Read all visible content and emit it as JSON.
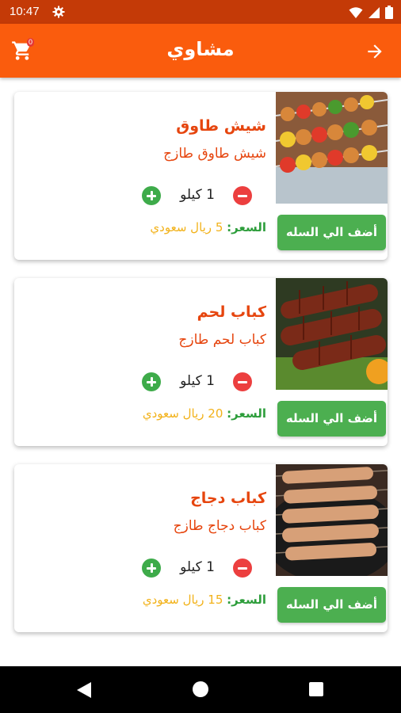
{
  "status_bar": {
    "time": "10:47",
    "icons": [
      "gear-icon",
      "wifi-icon",
      "signal-icon",
      "battery-icon"
    ]
  },
  "app_bar": {
    "title": "مشاوي",
    "cart_count": "0",
    "cart_icon": "cart-icon",
    "back_icon": "arrow-right-icon"
  },
  "colors": {
    "accent": "#fa5c0d",
    "status_bar": "#c43a07",
    "title_text": "#e6450e",
    "price_label": "#2e9e3c",
    "price_value": "#f2b21a",
    "add_button": "#4caf50",
    "minus": "#ec3f3f",
    "plus": "#3eab4a"
  },
  "products": [
    {
      "name": "شيش طاوق",
      "description": "شيش طاوق طازج",
      "quantity": "1 كيلو",
      "price_label": "السعر:",
      "price_value": "5 ريال سعودي",
      "add_label": "أضف الي السله",
      "image": "shish-tawook-photo"
    },
    {
      "name": "كباب لحم",
      "description": "كباب لحم طازج",
      "quantity": "1 كيلو",
      "price_label": "السعر:",
      "price_value": "20 ريال سعودي",
      "add_label": "أضف الي السله",
      "image": "meat-kebab-photo"
    },
    {
      "name": "كباب دجاج",
      "description": "كباب دجاج طازج",
      "quantity": "1 كيلو",
      "price_label": "السعر:",
      "price_value": "15 ريال سعودي",
      "add_label": "أضف الي السله",
      "image": "chicken-kebab-photo"
    }
  ]
}
